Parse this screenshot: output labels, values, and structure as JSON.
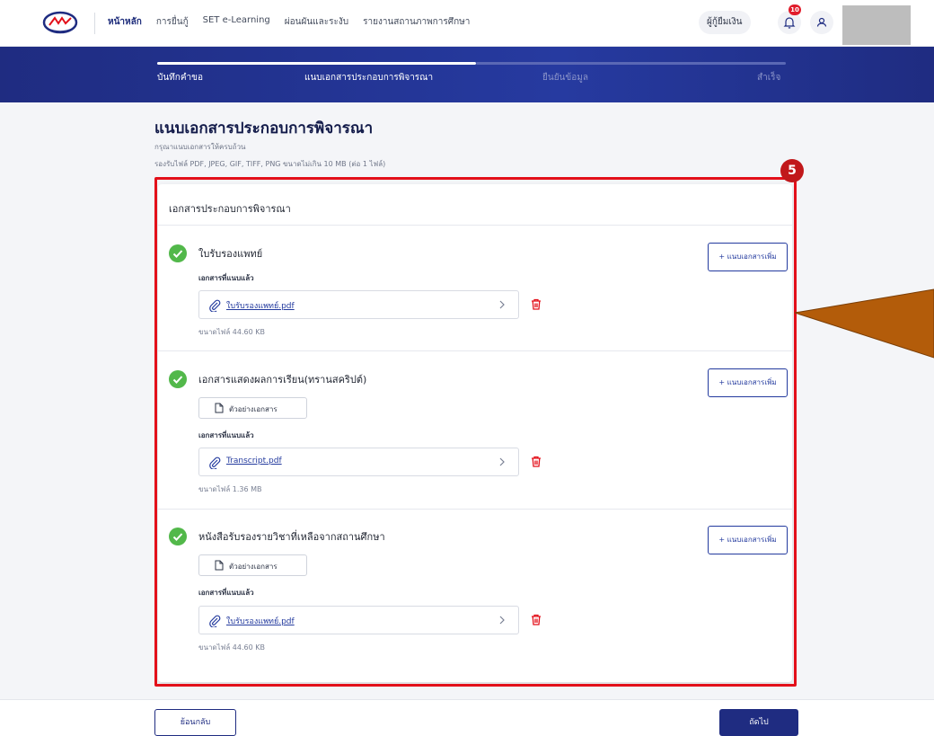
{
  "nav": {
    "links": [
      "หน้าหลัก",
      "การยื่นกู้",
      "SET e-Learning",
      "ผ่อนผันและระงับ",
      "รายงานสถานภาพการศึกษา"
    ],
    "user_role": "ผู้กู้ยืมเงิน",
    "notification_count": "10"
  },
  "stepper": {
    "steps": [
      "บันทึกคำขอ",
      "แนบเอกสารประกอบการพิจารณา",
      "ยืนยันข้อมูล",
      "สำเร็จ"
    ],
    "current_step": 2
  },
  "page": {
    "title": "แนบเอกสารประกอบการพิจารณา",
    "hint": "กรุณาแนบเอกสารให้ครบถ้วน",
    "accepted_formats": "รองรับไฟล์ PDF, JPEG, GIF, TIFF, PNG ขนาดไม่เกิน 10 MB (ต่อ 1 ไฟล์)"
  },
  "doc_card": {
    "title": "เอกสารประกอบการพิจารณา",
    "uploaded_label": "เอกสารที่แนบแล้ว",
    "add_button": "+ แนบเอกสารเพิ่ม",
    "sample_button": "ตัวอย่างเอกสาร",
    "requirements": [
      {
        "name": "ใบรับรองแพทย์",
        "file": "ใบรับรองแพทย์.pdf",
        "size": "ขนาดไฟล์ 44.60 KB",
        "has_sample": false
      },
      {
        "name": "เอกสารแสดงผลการเรียน(ทรานสคริปต์)",
        "file": "Transcript.pdf",
        "size": "ขนาดไฟล์ 1.36 MB",
        "has_sample": true
      },
      {
        "name": "หนังสือรับรองรายวิชาที่เหลือจากสถานศึกษา",
        "file": "ใบรับรองแพทย์.pdf",
        "size": "ขนาดไฟล์ 44.60 KB",
        "has_sample": true
      }
    ]
  },
  "annotation": {
    "marker": "5"
  },
  "footer": {
    "back_label": "ย้อนกลับ",
    "next_label": "ถัดไป"
  },
  "colors": {
    "primary": "#1f2c81",
    "check": "#52b84a",
    "highlight": "#e3101a",
    "callout": "#b35c0a",
    "trash": "#e3101a"
  }
}
